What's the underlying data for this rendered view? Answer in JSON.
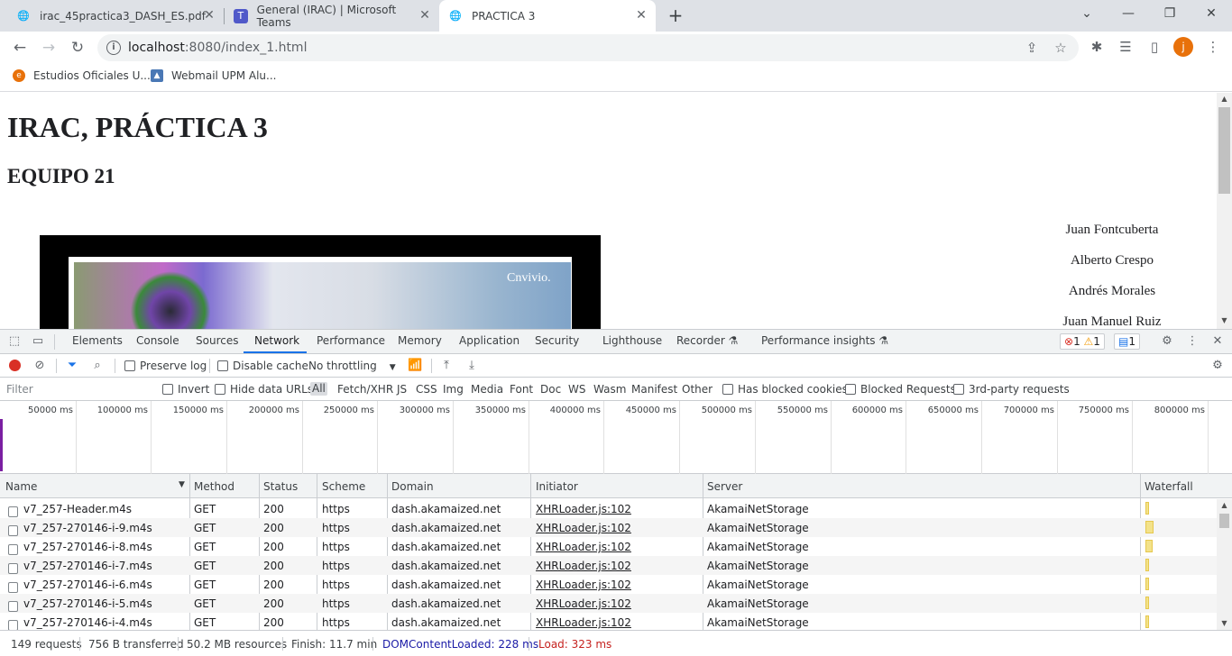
{
  "browser": {
    "tabs": [
      {
        "title": "irac_45practica3_DASH_ES.pdf",
        "icon": "globe-icon"
      },
      {
        "title": "General (IRAC) | Microsoft Teams",
        "icon": "teams-icon"
      },
      {
        "title": "PRACTICA 3",
        "icon": "globe-icon",
        "active": true
      }
    ],
    "new_tab": "+",
    "url_host": "localhost",
    "url_path": ":8080/index_1.html",
    "avatar_letter": "j",
    "bookmarks": [
      {
        "label": "Estudios Oficiales U...",
        "icon": "e-icon"
      },
      {
        "label": "Webmail UPM Alu...",
        "icon": "person-icon"
      }
    ],
    "accent": "#1a73e8",
    "avatar_color": "#e8710a"
  },
  "page": {
    "title": "IRAC, PRÁCTICA 3",
    "subtitle": "EQUIPO 21",
    "video_watermark": "Cnvivio.",
    "names": [
      "Juan Fontcuberta",
      "Alberto Crespo",
      "Andrés Morales",
      "Juan Manuel Ruiz"
    ]
  },
  "devtools": {
    "panels": [
      "Elements",
      "Console",
      "Sources",
      "Network",
      "Performance",
      "Memory",
      "Application",
      "Security",
      "Lighthouse",
      "Recorder",
      "Performance insights"
    ],
    "active_panel": "Network",
    "errors": "1",
    "warnings": "1",
    "messages": "1",
    "toolbar": {
      "preserve_log": "Preserve log",
      "disable_cache": "Disable cache",
      "throttling": "No throttling"
    },
    "filter": {
      "placeholder": "Filter",
      "invert": "Invert",
      "hide_data_urls": "Hide data URLs",
      "types": [
        "All",
        "Fetch/XHR",
        "JS",
        "CSS",
        "Img",
        "Media",
        "Font",
        "Doc",
        "WS",
        "Wasm",
        "Manifest",
        "Other"
      ],
      "selected_type": "All",
      "has_blocked_cookies": "Has blocked cookies",
      "blocked_requests": "Blocked Requests",
      "third_party": "3rd-party requests"
    },
    "overview_ticks": [
      "50000 ms",
      "100000 ms",
      "150000 ms",
      "200000 ms",
      "250000 ms",
      "300000 ms",
      "350000 ms",
      "400000 ms",
      "450000 ms",
      "500000 ms",
      "550000 ms",
      "600000 ms",
      "650000 ms",
      "700000 ms",
      "750000 ms",
      "800000 ms"
    ],
    "columns": [
      "Name",
      "Method",
      "Status",
      "Scheme",
      "Domain",
      "Initiator",
      "Server",
      "Waterfall"
    ],
    "rows": [
      {
        "name": "v7_257-Header.m4s",
        "method": "GET",
        "status": "200",
        "scheme": "https",
        "domain": "dash.akamaized.net",
        "initiator": "XHRLoader.js:102",
        "server": "AkamaiNetStorage"
      },
      {
        "name": "v7_257-270146-i-9.m4s",
        "method": "GET",
        "status": "200",
        "scheme": "https",
        "domain": "dash.akamaized.net",
        "initiator": "XHRLoader.js:102",
        "server": "AkamaiNetStorage"
      },
      {
        "name": "v7_257-270146-i-8.m4s",
        "method": "GET",
        "status": "200",
        "scheme": "https",
        "domain": "dash.akamaized.net",
        "initiator": "XHRLoader.js:102",
        "server": "AkamaiNetStorage"
      },
      {
        "name": "v7_257-270146-i-7.m4s",
        "method": "GET",
        "status": "200",
        "scheme": "https",
        "domain": "dash.akamaized.net",
        "initiator": "XHRLoader.js:102",
        "server": "AkamaiNetStorage"
      },
      {
        "name": "v7_257-270146-i-6.m4s",
        "method": "GET",
        "status": "200",
        "scheme": "https",
        "domain": "dash.akamaized.net",
        "initiator": "XHRLoader.js:102",
        "server": "AkamaiNetStorage"
      },
      {
        "name": "v7_257-270146-i-5.m4s",
        "method": "GET",
        "status": "200",
        "scheme": "https",
        "domain": "dash.akamaized.net",
        "initiator": "XHRLoader.js:102",
        "server": "AkamaiNetStorage"
      },
      {
        "name": "v7_257-270146-i-4.m4s",
        "method": "GET",
        "status": "200",
        "scheme": "https",
        "domain": "dash.akamaized.net",
        "initiator": "XHRLoader.js:102",
        "server": "AkamaiNetStorage"
      }
    ],
    "status": {
      "requests": "149 requests",
      "transferred": "756 B transferred",
      "resources": "50.2 MB resources",
      "finish": "Finish: 11.7 min",
      "dom": "DOMContentLoaded: 228 ms",
      "load": "Load: 323 ms",
      "dom_color": "#1a1aa6",
      "load_color": "#c5221f"
    }
  }
}
